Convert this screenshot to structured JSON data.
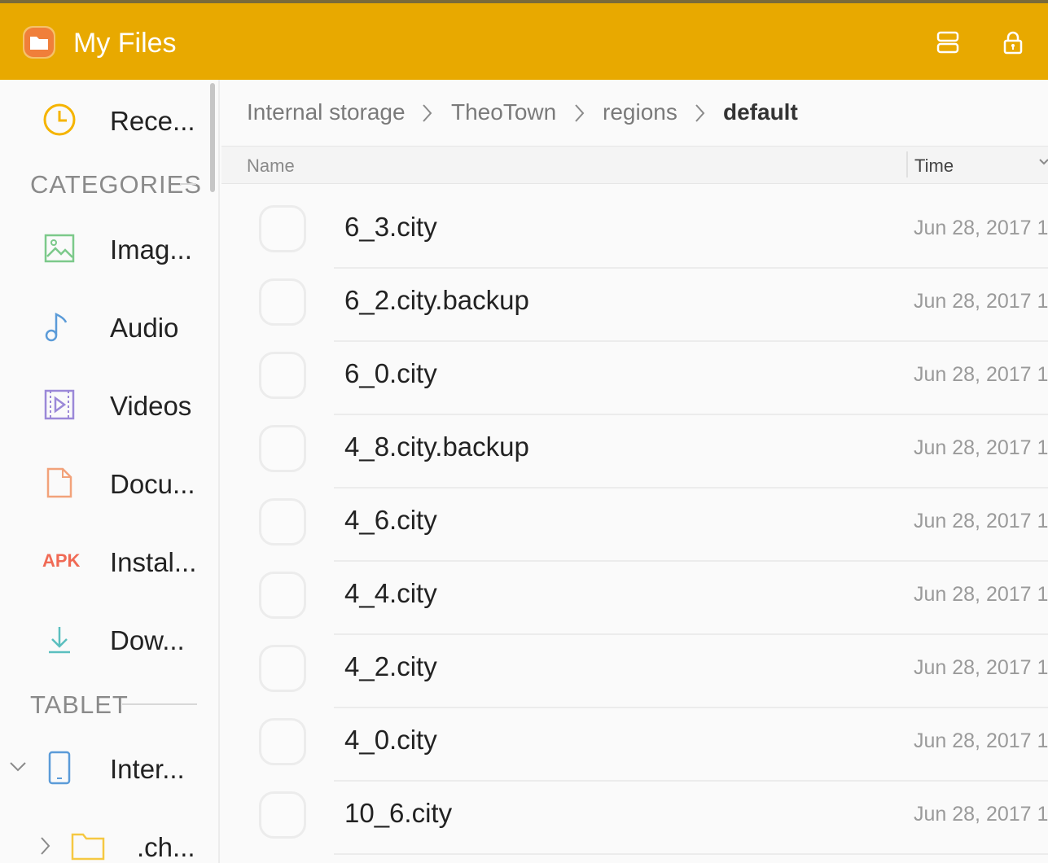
{
  "app": {
    "title": "My Files",
    "header_color": "#e8a900",
    "icons": [
      "folder-icon",
      "view-toggle-icon",
      "lock-icon"
    ]
  },
  "sidebar": {
    "recent": {
      "label": "Rece...",
      "icon": "clock-icon"
    },
    "categories_header": "CATEGORIES",
    "categories": [
      {
        "label": "Imag...",
        "icon": "image-icon"
      },
      {
        "label": "Audio",
        "icon": "music-note-icon"
      },
      {
        "label": "Videos",
        "icon": "video-icon"
      },
      {
        "label": "Docu...",
        "icon": "document-icon"
      },
      {
        "label": "Instal...",
        "icon": "apk-icon",
        "icon_text": "APK"
      },
      {
        "label": "Dow...",
        "icon": "download-icon"
      }
    ],
    "tablet_header": "TABLET",
    "storage": {
      "label": "Inter...",
      "icon": "tablet-icon"
    },
    "folder": {
      "label": ".ch...",
      "icon": "folder-icon"
    }
  },
  "breadcrumb": [
    "Internal storage",
    "TheoTown",
    "regions",
    "default"
  ],
  "columns": {
    "name": "Name",
    "time": "Time"
  },
  "files": [
    {
      "name": "6_3.city",
      "time": "Jun 28, 2017 1"
    },
    {
      "name": "6_2.city.backup",
      "time": "Jun 28, 2017 1"
    },
    {
      "name": "6_0.city",
      "time": "Jun 28, 2017 1"
    },
    {
      "name": "4_8.city.backup",
      "time": "Jun 28, 2017 1"
    },
    {
      "name": "4_6.city",
      "time": "Jun 28, 2017 1"
    },
    {
      "name": "4_4.city",
      "time": "Jun 28, 2017 1"
    },
    {
      "name": "4_2.city",
      "time": "Jun 28, 2017 1"
    },
    {
      "name": "4_0.city",
      "time": "Jun 28, 2017 1"
    },
    {
      "name": "10_6.city",
      "time": "Jun 28, 2017 1"
    }
  ]
}
